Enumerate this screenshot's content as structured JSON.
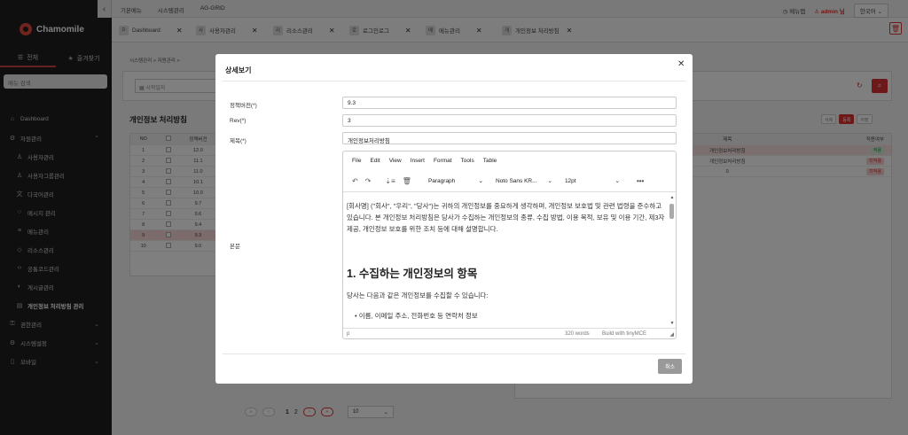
{
  "app": {
    "name": "Chamomile"
  },
  "sidebar": {
    "tabs": [
      {
        "label": "전체",
        "icon": "list-icon"
      },
      {
        "label": "즐겨찾기",
        "icon": "star-icon"
      }
    ],
    "search_placeholder": "메뉴 검색",
    "items": [
      {
        "label": "Dashboard"
      },
      {
        "label": "자원관리"
      },
      {
        "label": "사용자관리"
      },
      {
        "label": "사용자그룹관리"
      },
      {
        "label": "다국어관리"
      },
      {
        "label": "메시지 관리"
      },
      {
        "label": "메뉴관리"
      },
      {
        "label": "리소스관리"
      },
      {
        "label": "공통코드관리"
      },
      {
        "label": "게시글관리"
      },
      {
        "label": "개인정보 처리방침 관리"
      },
      {
        "label": "권한관리"
      },
      {
        "label": "시스템설정"
      },
      {
        "label": "모바일"
      }
    ]
  },
  "topbar": {
    "nav": [
      "기본메뉴",
      "시스템관리",
      "AG-GRID"
    ],
    "menu_map": "메뉴맵",
    "user": "admin 님",
    "language": "한국어"
  },
  "tabs": [
    {
      "label": "Dashboard",
      "badge": "D"
    },
    {
      "label": "사용자관리",
      "badge": "사"
    },
    {
      "label": "리소스관리",
      "badge": "리"
    },
    {
      "label": "로그인로그",
      "badge": "로"
    },
    {
      "label": "메뉴관리",
      "badge": "메"
    },
    {
      "label": "개인정보 처리방침",
      "badge": "개"
    }
  ],
  "breadcrumb": "시스템관리  >  자원관리  >",
  "search": {
    "date_placeholder": "시작일자"
  },
  "list": {
    "title": "개인정보 처리방침",
    "columns": [
      "NO",
      "",
      "정책버전"
    ],
    "rows": [
      {
        "no": "1",
        "ver": "12.0"
      },
      {
        "no": "2",
        "ver": "11.1"
      },
      {
        "no": "3",
        "ver": "11.0"
      },
      {
        "no": "4",
        "ver": "10.1"
      },
      {
        "no": "5",
        "ver": "10.0"
      },
      {
        "no": "6",
        "ver": "9.7"
      },
      {
        "no": "7",
        "ver": "9.6"
      },
      {
        "no": "8",
        "ver": "9.4"
      },
      {
        "no": "9",
        "ver": "9.3"
      },
      {
        "no": "10",
        "ver": "9.0"
      }
    ],
    "selected_row": "9"
  },
  "actions": {
    "delete": "삭제",
    "register": "등록",
    "save": "저장"
  },
  "right_grid": {
    "columns": [
      "제목",
      "적용여부"
    ],
    "rows": [
      {
        "title": "개인정보처리방침",
        "status": "적용"
      },
      {
        "title": "개인정보처리방침",
        "status": "미적용"
      },
      {
        "title": "0",
        "status": "미적용"
      }
    ]
  },
  "pagination": {
    "pages": [
      "1",
      "2"
    ],
    "page_size": "10"
  },
  "modal": {
    "title": "상세보기",
    "fields": [
      {
        "label": "정책버전(*)",
        "value": "9.3"
      },
      {
        "label": "Rev(*)",
        "value": "3"
      },
      {
        "label": "제목(*)",
        "value": "개인정보처리방침"
      }
    ],
    "body_label": "본문",
    "editor": {
      "menus": [
        "File",
        "Edit",
        "View",
        "Insert",
        "Format",
        "Tools",
        "Table"
      ],
      "block_format": "Paragraph",
      "font_family": "Noto Sans KR...",
      "font_size": "12pt",
      "content_p1": "[회사명] (\"회사\", \"우리\", \"당사\")는 귀하의 개인정보를 중요하게 생각하며, 개인정보 보호법 및 관련 법령을 준수하고 있습니다. 본 개인정보 처리방침은 당사가 수집하는 개인정보의 종류, 수집 방법, 이용 목적, 보유 및 이용 기간, 제3자 제공, 개인정보 보호를 위한 조치 등에 대해 설명합니다.",
      "content_h1": "1. 수집하는 개인정보의 항목",
      "content_p2": "당사는 다음과 같은 개인정보를 수집할 수 있습니다:",
      "content_li": "이름, 이메일 주소, 전화번호 등 연락처 정보",
      "status_path": "p",
      "word_count": "320 words",
      "brand": "Build with tinyMCE"
    },
    "cancel": "취소"
  }
}
